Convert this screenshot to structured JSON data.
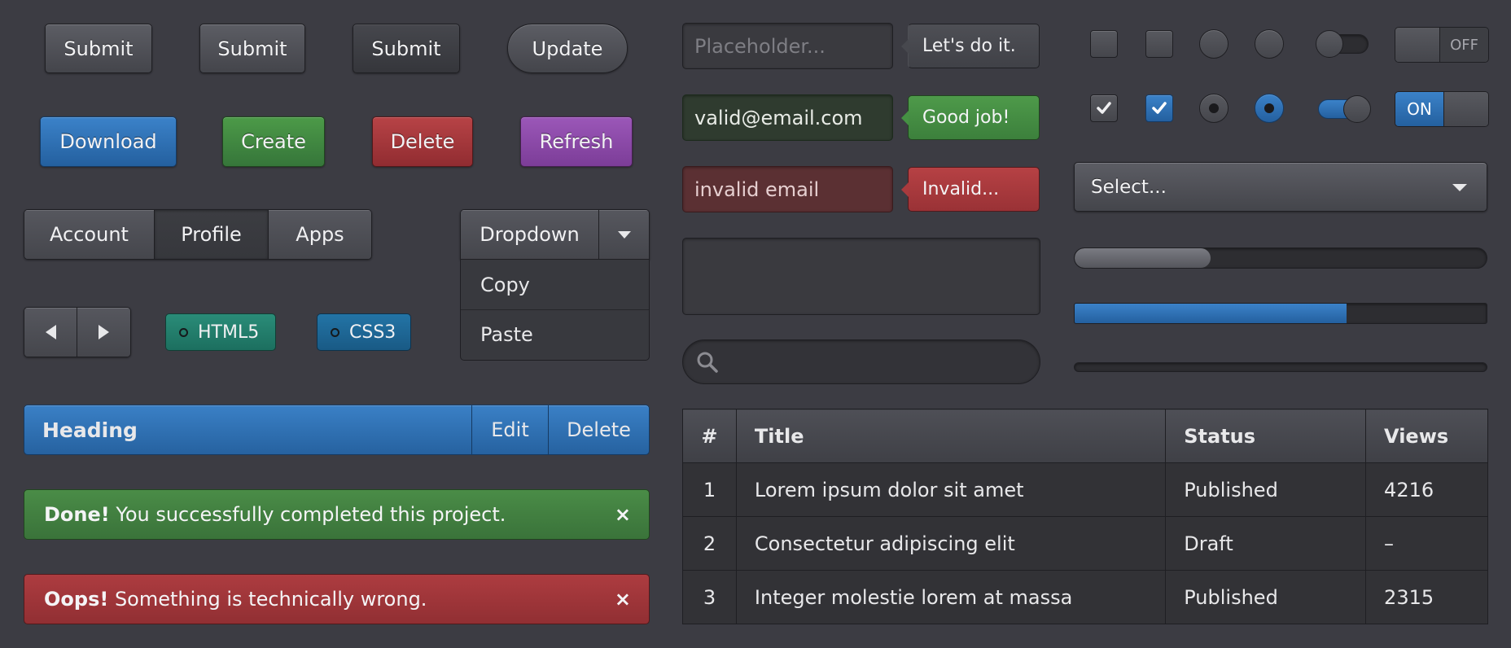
{
  "buttons_row1": [
    "Submit",
    "Submit",
    "Submit",
    "Update"
  ],
  "buttons_row2": [
    "Download",
    "Create",
    "Delete",
    "Refresh"
  ],
  "segmented": [
    "Account",
    "Profile",
    "Apps"
  ],
  "dropdown": {
    "label": "Dropdown",
    "items": [
      "Copy",
      "Paste"
    ]
  },
  "badges": [
    "HTML5",
    "CSS3"
  ],
  "heading_bar": {
    "title": "Heading",
    "edit": "Edit",
    "delete": "Delete"
  },
  "alerts": {
    "success": {
      "strong": "Done!",
      "text": " You successfully completed this project.",
      "close": "×"
    },
    "error": {
      "strong": "Oops!",
      "text": " Something is technically wrong.",
      "close": "×"
    }
  },
  "inputs": {
    "placeholder": "Placeholder...",
    "valid_value": "valid@email.com",
    "invalid_value": "invalid email"
  },
  "tips": {
    "default": "Let's do it.",
    "success": "Good job!",
    "error": "Invalid..."
  },
  "switch_labels": {
    "off": "OFF",
    "on": "ON"
  },
  "select": {
    "label": "Select..."
  },
  "progress": {
    "bar1": 0.33,
    "bar2": 0.66,
    "bar3": 0
  },
  "table": {
    "headers": [
      "#",
      "Title",
      "Status",
      "Views"
    ],
    "rows": [
      [
        "1",
        "Lorem ipsum dolor sit amet",
        "Published",
        "4216"
      ],
      [
        "2",
        "Consectetur adipiscing elit",
        "Draft",
        "–"
      ],
      [
        "3",
        "Integer molestie lorem at massa",
        "Published",
        "2315"
      ]
    ]
  },
  "colors": {
    "background": "#3c3c43",
    "blue": "#2f72b8",
    "green": "#41883f",
    "red": "#a3383c",
    "purple": "#8b4aa8",
    "teal": "#1f7d6b"
  }
}
